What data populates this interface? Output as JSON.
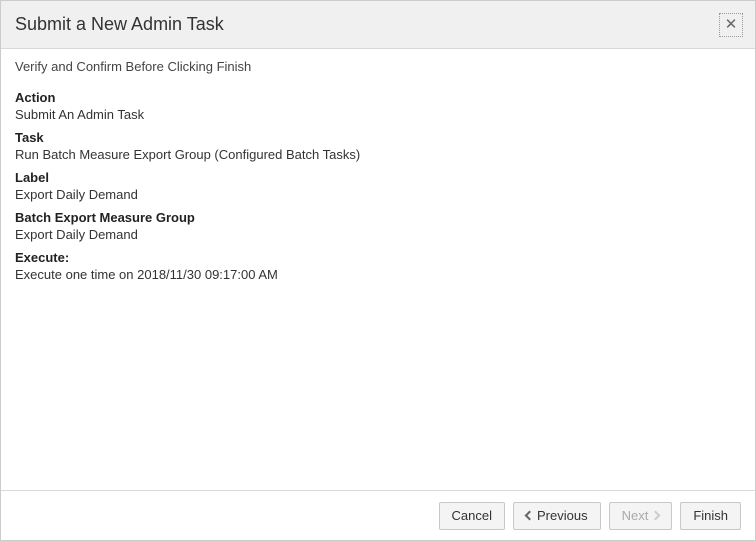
{
  "header": {
    "title": "Submit a New Admin Task"
  },
  "subheader": "Verify and Confirm Before Clicking Finish",
  "fields": {
    "action": {
      "label": "Action",
      "value": "Submit An Admin Task"
    },
    "task": {
      "label": "Task",
      "value": "Run Batch Measure Export Group (Configured Batch Tasks)"
    },
    "labelField": {
      "label": "Label",
      "value": "Export Daily Demand"
    },
    "group": {
      "label": "Batch Export Measure Group",
      "value": "Export Daily Demand"
    },
    "execute": {
      "label": "Execute:",
      "value": "Execute one time on 2018/11/30 09:17:00 AM"
    }
  },
  "buttons": {
    "cancel": "Cancel",
    "previous": "Previous",
    "next": "Next",
    "finish": "Finish"
  }
}
